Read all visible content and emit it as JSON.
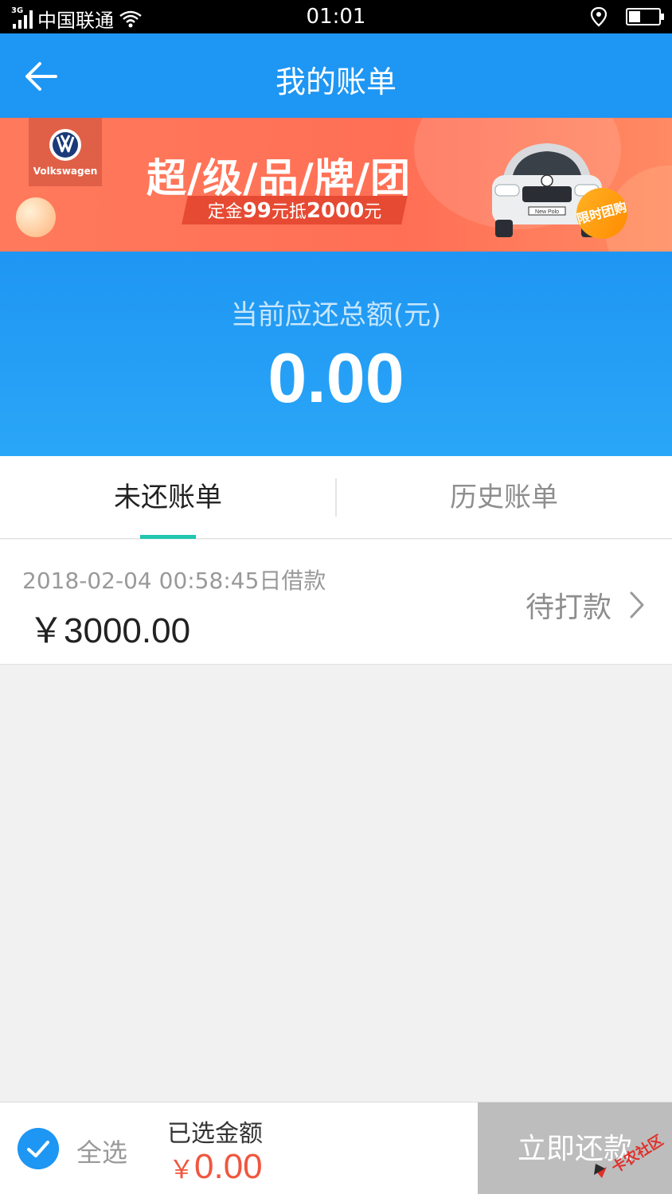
{
  "status_bar": {
    "carrier": "中国联通",
    "network": "3G",
    "time": "01:01"
  },
  "header": {
    "title": "我的账单"
  },
  "banner": {
    "brand": "Volkswagen",
    "title": "超/级/品/牌/团",
    "subtitle_prefix": "定金",
    "deposit": "99",
    "subtitle_middle": "元抵",
    "discount": "2000",
    "subtitle_suffix": "元",
    "badge": "限时团购",
    "car_plate": "New Polo"
  },
  "summary": {
    "label": "当前应还总额(元)",
    "amount": "0.00"
  },
  "tabs": [
    {
      "label": "未还账单",
      "active": true
    },
    {
      "label": "历史账单",
      "active": false
    }
  ],
  "bills": [
    {
      "date": "2018-02-04 00:58:45日借款",
      "amount": "￥3000.00",
      "status": "待打款"
    }
  ],
  "bottom_bar": {
    "select_all": "全选",
    "selected_label": "已选金额",
    "currency": "￥",
    "selected_amount": "0.00",
    "pay_button": "立即还款"
  },
  "watermark": "卡农社区",
  "colors": {
    "primary": "#1e96f3",
    "accent": "#21c6b0",
    "price": "#f0563e",
    "disabled": "#bdbdbd"
  },
  "battery_level_percent": 45
}
